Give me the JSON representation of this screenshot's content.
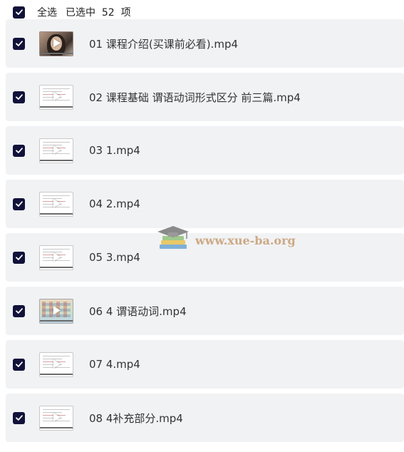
{
  "header": {
    "select_all_label": "全选",
    "selection_summary": "已选中  52  项"
  },
  "items": [
    {
      "title": "01 课程介绍(买课前必看).mp4",
      "thumb": "photo"
    },
    {
      "title": "02 课程基础 谓语动词形式区分 前三篇.mp4",
      "thumb": "doc"
    },
    {
      "title": "03 1.mp4",
      "thumb": "doc"
    },
    {
      "title": "04 2.mp4",
      "thumb": "doc"
    },
    {
      "title": "05 3.mp4",
      "thumb": "doc"
    },
    {
      "title": "06 4 谓语动词.mp4",
      "thumb": "map"
    },
    {
      "title": "07 4.mp4",
      "thumb": "doc"
    },
    {
      "title": "08 4补充部分.mp4",
      "thumb": "doc"
    }
  ],
  "watermark": {
    "text": "www.xue-ba.org",
    "icon": "graduation-cap-books-icon"
  },
  "colors": {
    "checkbox": "#11123a",
    "row_bg": "#f1f2f4",
    "watermark_text": "#c9a27a"
  },
  "icons": {
    "checkbox": "checkmark-icon",
    "thumbnail_overlay": "play-icon"
  }
}
